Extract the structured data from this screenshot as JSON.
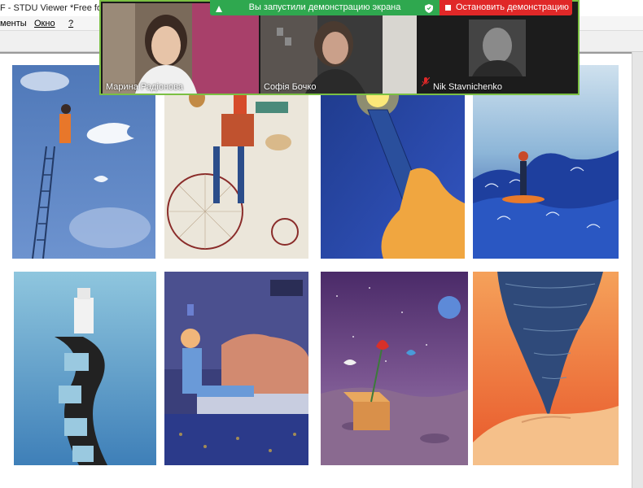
{
  "window": {
    "title": "F - STDU Viewer *Free for n"
  },
  "menu": {
    "items": [
      "менты",
      "Окно",
      "?"
    ]
  },
  "zoom": {
    "share_banner": "Вы запустили демонстрацию экрана",
    "stop_button": "Остановить демонстрацию",
    "participants": [
      {
        "name": "Марина Радіонова"
      },
      {
        "name": "Софія Бочко"
      },
      {
        "name": "Nik Stavnichenko"
      }
    ]
  },
  "colors": {
    "zoom_green": "#2fa84f",
    "zoom_red": "#e02828",
    "active_speaker_border": "#7bc043"
  },
  "illustrations": [
    "girl-on-ladder-painting-dove",
    "men-on-penny-farthing-bicycle",
    "hand-holding-torch",
    "surfer-girl-on-ocean-wave",
    "man-sitting-on-film-strip",
    "boy-sleeping-on-bed",
    "flower-in-box-on-moon",
    "tornado-over-open-hand"
  ]
}
